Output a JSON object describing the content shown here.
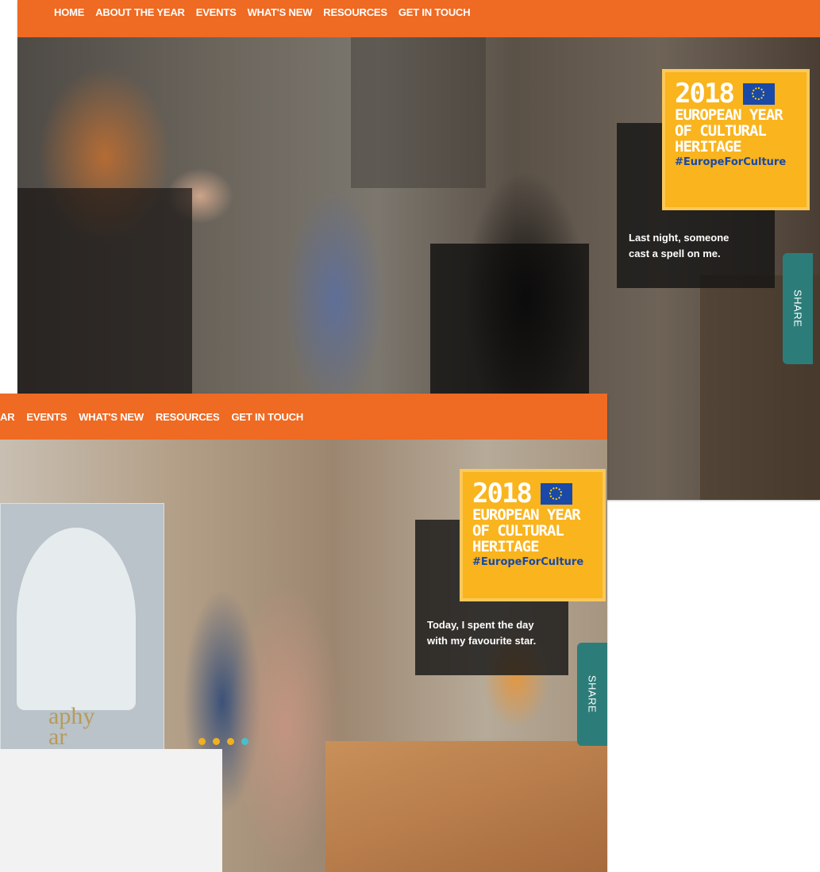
{
  "screenshot_back": {
    "nav": [
      "HOME",
      "ABOUT THE YEAR",
      "EVENTS",
      "WHAT'S NEW",
      "RESOURCES",
      "GET IN TOUCH"
    ],
    "badge": {
      "year": "2018",
      "line1": "EUROPEAN YEAR",
      "line2": "OF CULTURAL",
      "line3": "HERITAGE",
      "hashtag": "#EuropeForCulture"
    },
    "caption_line1": "Last night, someone",
    "caption_line2": "cast a spell on me.",
    "share_label": "SHARE"
  },
  "screenshot_front": {
    "nav": [
      "AR",
      "EVENTS",
      "WHAT'S NEW",
      "RESOURCES",
      "GET IN TOUCH"
    ],
    "badge": {
      "year": "2018",
      "line1": "EUROPEAN YEAR",
      "line2": "OF CULTURAL",
      "line3": "HERITAGE",
      "hashtag": "#EuropeForCulture"
    },
    "caption_line1": "Today, I spent the day",
    "caption_line2": "with my favourite star.",
    "share_label": "SHARE",
    "magazine_text": "aphy\nar",
    "carousel": {
      "count": 4,
      "active_index": 3,
      "dot_color": "#f0b020",
      "active_color": "#48c0c8"
    }
  },
  "colors": {
    "nav_orange": "#ef6a22",
    "badge_yellow": "#f9b41e",
    "eu_blue": "#1a49a8",
    "share_teal": "#2c7d79"
  }
}
